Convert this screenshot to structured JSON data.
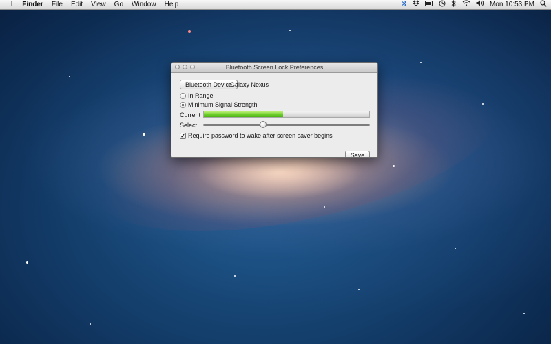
{
  "menubar": {
    "apple_icon": "apple-icon",
    "items": [
      {
        "label": "Finder",
        "app": true
      },
      {
        "label": "File"
      },
      {
        "label": "Edit"
      },
      {
        "label": "View"
      },
      {
        "label": "Go"
      },
      {
        "label": "Window"
      },
      {
        "label": "Help"
      }
    ],
    "status_icons": [
      "bluetooth-icon",
      "dropbox-icon",
      "battery-icon",
      "time-machine-icon",
      "bluetooth-icon",
      "wifi-icon",
      "volume-icon"
    ],
    "clock": "Mon 10:53 PM",
    "spotlight_icon": "search-icon"
  },
  "window": {
    "title": "Bluetooth Screen Lock Preferences",
    "device_button_label": "Bluetooth Device",
    "device_name": "Galaxy Nexus",
    "radio_in_range": {
      "label": "In Range",
      "checked": false
    },
    "radio_min_signal": {
      "label": "Minimum Signal Strength",
      "checked": true
    },
    "current_label": "Current",
    "current_signal_level": 0.48,
    "select_label": "Select",
    "select_level": 0.36,
    "require_password": {
      "label": "Require password to wake after screen saver begins",
      "checked": true
    },
    "save_label": "Save"
  },
  "colors": {
    "signal_fill": "#6fcf2c",
    "window_bg": "#ececec"
  }
}
